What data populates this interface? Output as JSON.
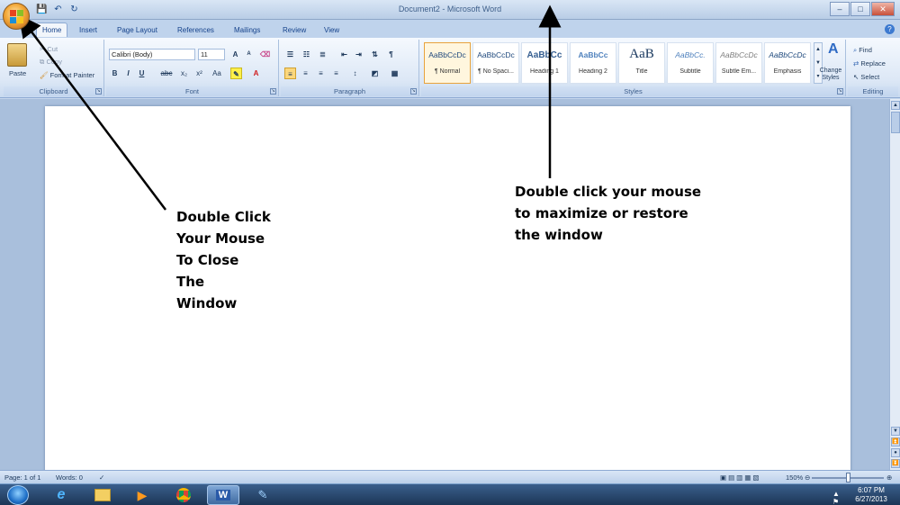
{
  "window": {
    "title": "Document2 - Microsoft Word",
    "controls": {
      "minimize": "–",
      "maximize": "□",
      "close": "✕"
    }
  },
  "quick_access": {
    "save": "💾",
    "undo": "↶",
    "redo": "↻"
  },
  "tabs": [
    "Home",
    "Insert",
    "Page Layout",
    "References",
    "Mailings",
    "Review",
    "View"
  ],
  "ribbon": {
    "clipboard": {
      "label": "Clipboard",
      "paste": "Paste",
      "cut": "Cut",
      "copy": "Copy",
      "format_painter": "Format Painter"
    },
    "font": {
      "label": "Font",
      "font_name": "Calibri (Body)",
      "font_size": "11",
      "bold": "B",
      "italic": "I",
      "underline": "U",
      "strike": "abc",
      "subscript": "x₂",
      "superscript": "x²",
      "change_case": "Aa",
      "grow": "A",
      "shrink": "A"
    },
    "paragraph": {
      "label": "Paragraph"
    },
    "styles": {
      "label": "Styles",
      "tiles": [
        {
          "preview": "AaBbCcDc",
          "name": "¶ Normal"
        },
        {
          "preview": "AaBbCcDc",
          "name": "¶ No Spaci..."
        },
        {
          "preview": "AaBbCc",
          "name": "Heading 1"
        },
        {
          "preview": "AaBbCc",
          "name": "Heading 2"
        },
        {
          "preview": "AaB",
          "name": "Title"
        },
        {
          "preview": "AaBbCc.",
          "name": "Subtitle"
        },
        {
          "preview": "AaBbCcDc",
          "name": "Subtle Em..."
        },
        {
          "preview": "AaBbCcDc",
          "name": "Emphasis"
        }
      ],
      "change_styles": "Change Styles"
    },
    "editing": {
      "label": "Editing",
      "find": "Find",
      "replace": "Replace",
      "select": "Select"
    }
  },
  "annotations": {
    "close_note": "Double Click\nYour Mouse\nTo Close\nThe\nWindow",
    "maximize_note": "Double click your mouse\nto maximize or restore\nthe window"
  },
  "statusbar": {
    "page": "Page: 1 of 1",
    "words": "Words: 0",
    "zoom": "150%"
  },
  "tray": {
    "time": "6:07 PM",
    "date": "6/27/2013"
  },
  "colors": {
    "ribbon_bg": "#dde8f6",
    "title_bg": "#c7d8ee",
    "taskbar_bg": "#1c3656",
    "office_orb": "#f3a93a"
  }
}
